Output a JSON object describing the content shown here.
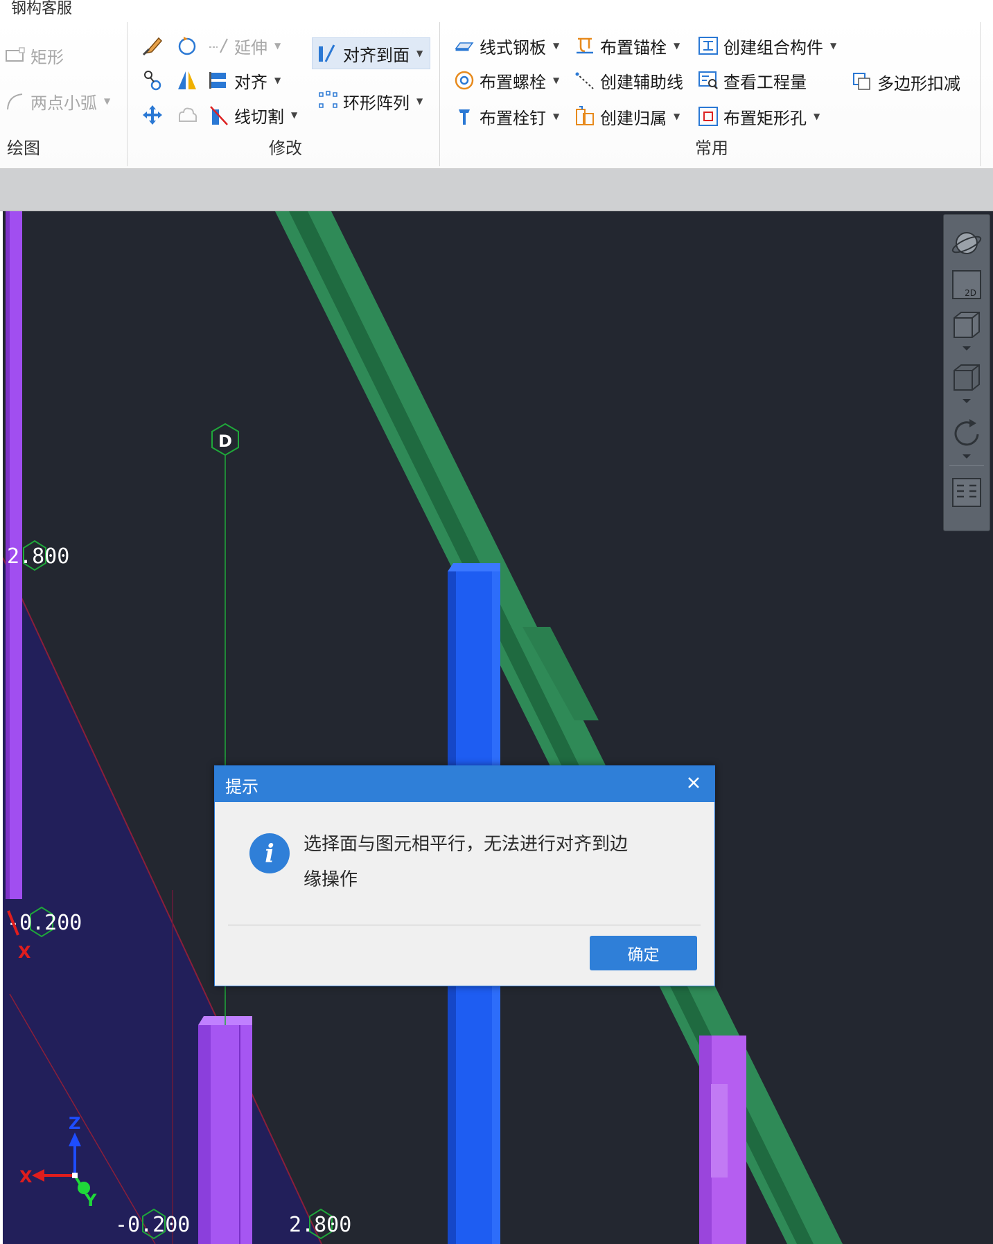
{
  "window": {
    "title": "钢构客服"
  },
  "ribbon": {
    "groups": {
      "draw": {
        "label": "绘图",
        "items": [
          "矩形",
          "两点小弧"
        ]
      },
      "modify": {
        "label": "修改",
        "items": {
          "extend": "延伸",
          "align": "对齐",
          "line_cut": "线切割",
          "align_to_face": "对齐到面",
          "ring_array": "环形阵列"
        }
      },
      "common": {
        "label": "常用",
        "items": {
          "line_plate": "线式钢板",
          "anchor_bolt": "布置锚栓",
          "create_assembly": "创建组合构件",
          "polygon_deduct": "多边形扣减",
          "bolt": "布置螺栓",
          "aux_line": "创建辅助线",
          "view_quantity": "查看工程量",
          "stud": "布置栓钉",
          "create_belonging": "创建归属",
          "rect_hole": "布置矩形孔"
        }
      }
    }
  },
  "viewport": {
    "axis_marker": "D",
    "elevations": {
      "left_top": "2.800",
      "left_mid": "-0.200",
      "bottom_left": "-0.200",
      "bottom_right": "2.800"
    },
    "axis_labels": {
      "x": "X",
      "y": "Y",
      "z": "Z",
      "x_red": "X"
    },
    "view_tools": [
      "orbit-icon",
      "view-2d-icon",
      "view-3d-wire-icon",
      "view-3d-solid-icon",
      "rotate-icon",
      "layer-list-icon"
    ],
    "view_2d_label": "2D"
  },
  "dialog": {
    "title": "提示",
    "message_line1": "选择面与图元相平行，无法进行对齐到边",
    "message_line2": "缘操作",
    "ok_label": "确定"
  },
  "colors": {
    "viewport_bg": "#232730",
    "dialog_header": "#2f7fd8",
    "beam_green": "#2d8a55",
    "column_blue": "#1e5df2",
    "column_purple": "#b55ef0",
    "floor_region": "#221f5a"
  }
}
